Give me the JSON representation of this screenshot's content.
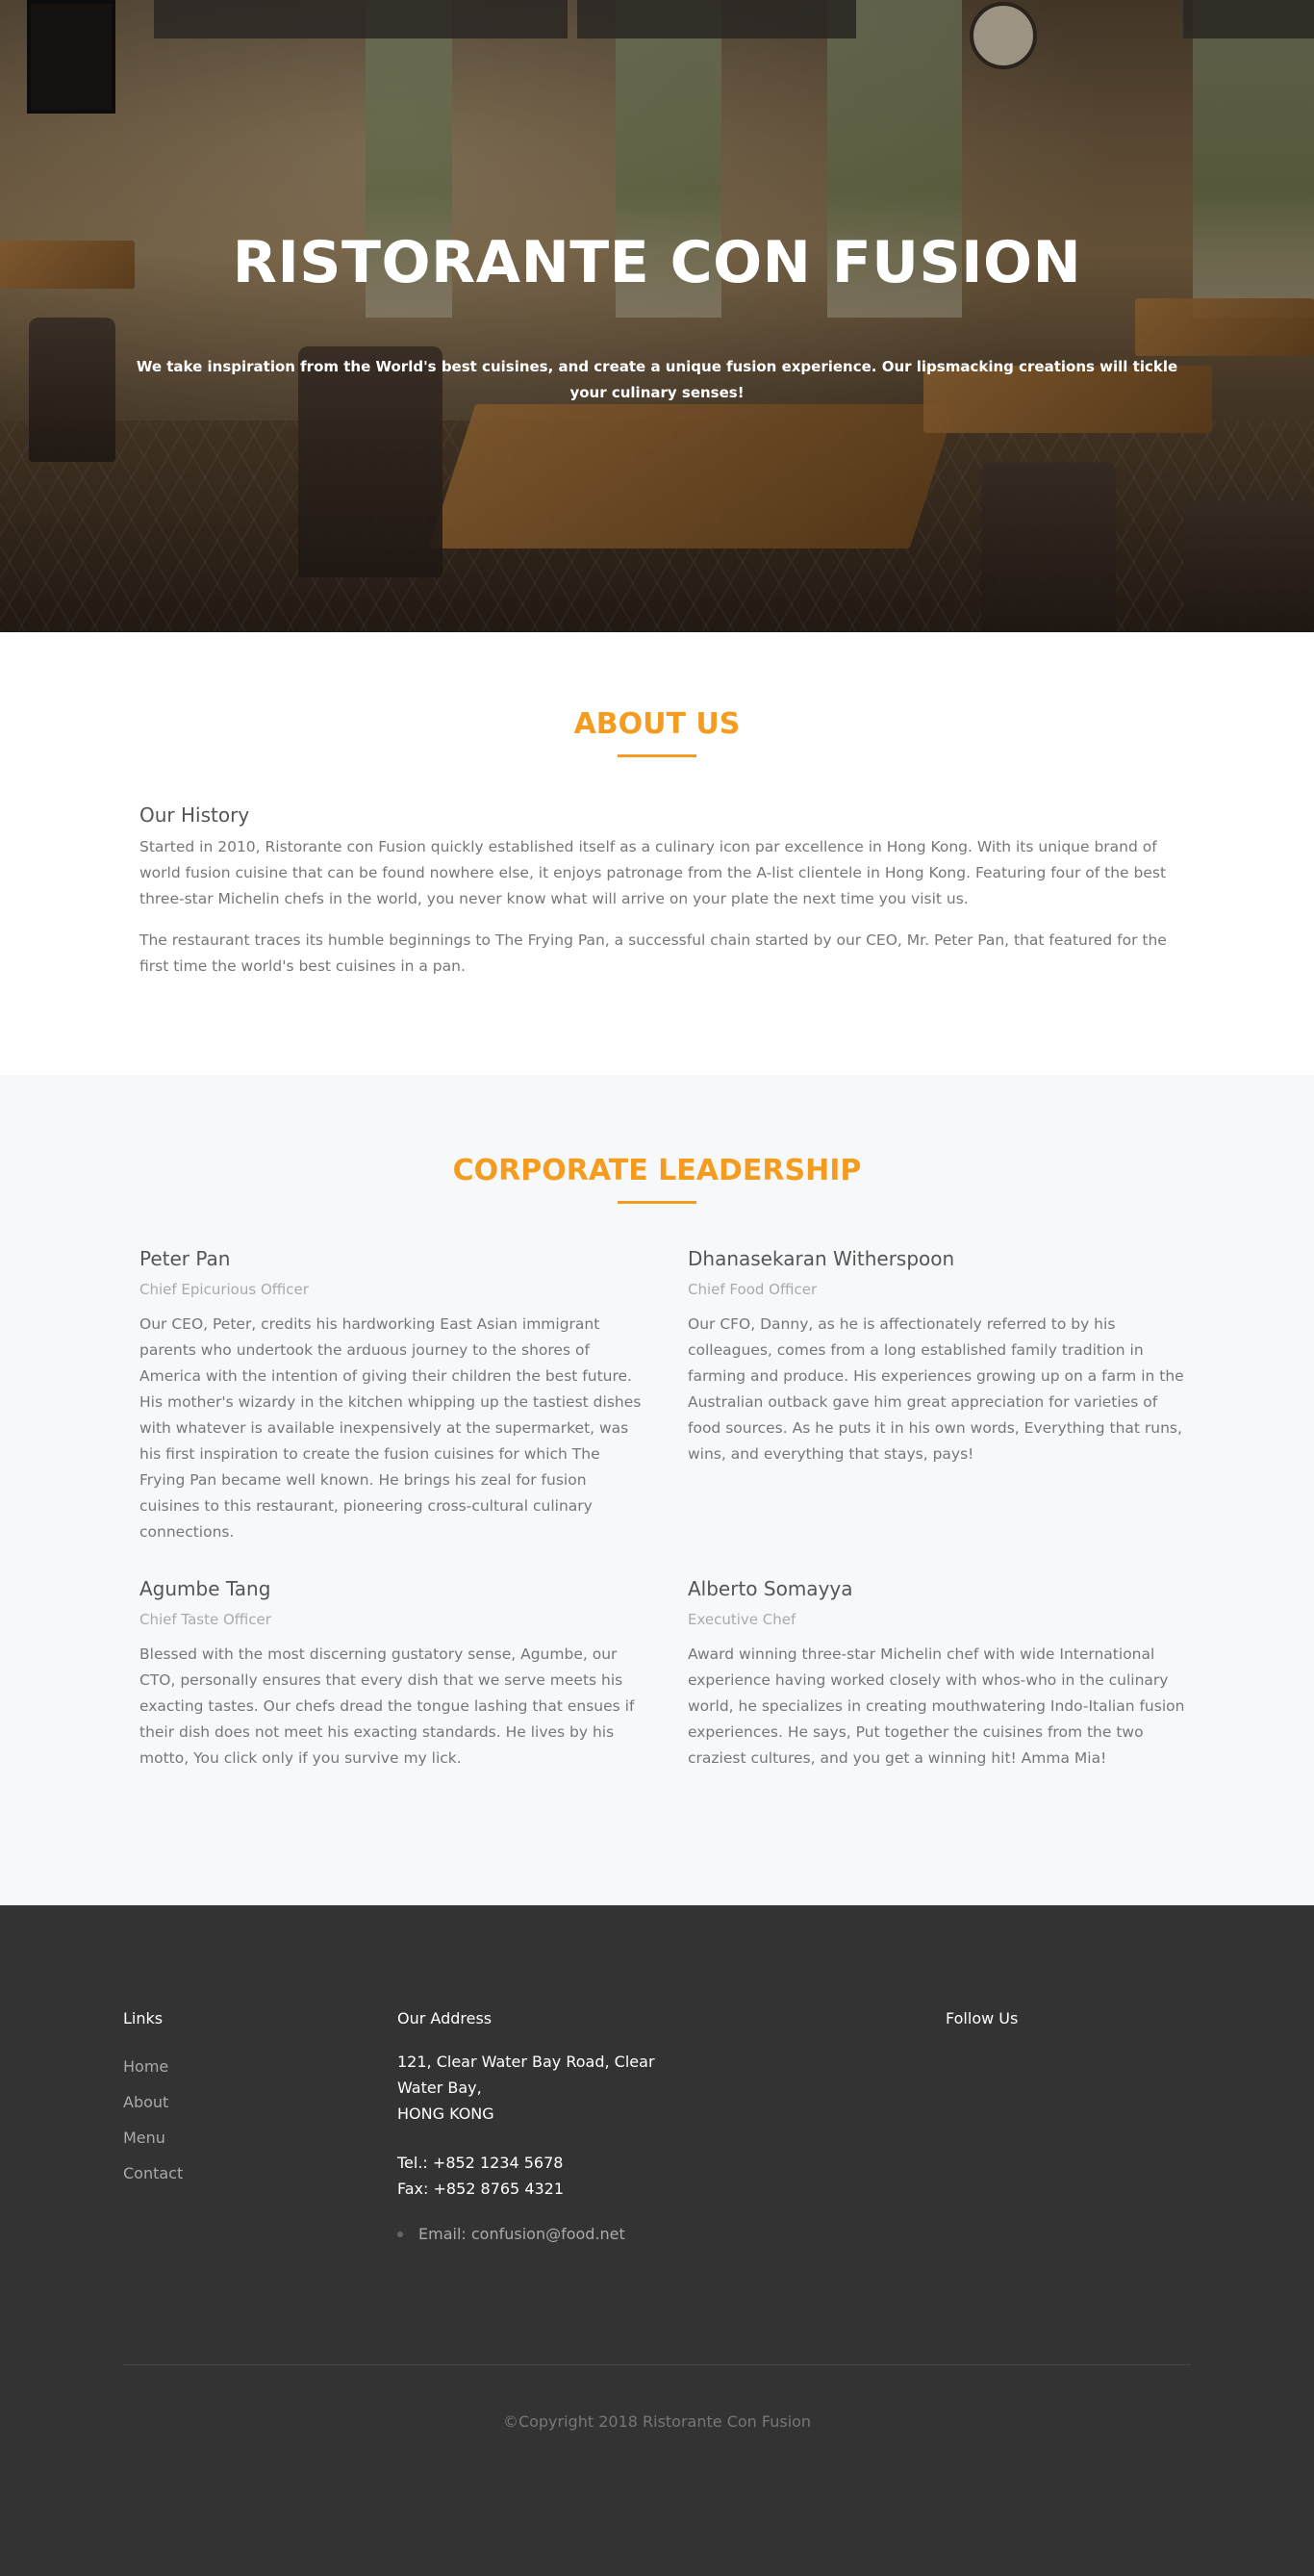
{
  "hero": {
    "title": "RISTORANTE CON FUSION",
    "subtitle": "We take inspiration from the World's best cuisines, and create a unique fusion experience. Our lipsmacking creations will tickle your culinary senses!"
  },
  "about": {
    "title": "ABOUT US",
    "heading": "Our History",
    "paragraphs": [
      "Started in 2010, Ristorante con Fusion quickly established itself as a culinary icon par excellence in Hong Kong. With its unique brand of world fusion cuisine that can be found nowhere else, it enjoys patronage from the A-list clientele in Hong Kong. Featuring four of the best three-star Michelin chefs in the world, you never know what will arrive on your plate the next time you visit us.",
      "The restaurant traces its humble beginnings to The Frying Pan, a successful chain started by our CEO, Mr. Peter Pan, that featured for the first time the world's best cuisines in a pan."
    ]
  },
  "leadership": {
    "title": "CORPORATE LEADERSHIP",
    "leaders": [
      {
        "name": "Peter Pan",
        "role": "Chief Epicurious Officer",
        "bio": "Our CEO, Peter, credits his hardworking East Asian immigrant parents who undertook the arduous journey to the shores of America with the intention of giving their children the best future. His mother's wizardy in the kitchen whipping up the tastiest dishes with whatever is available inexpensively at the supermarket, was his first inspiration to create the fusion cuisines for which The Frying Pan became well known. He brings his zeal for fusion cuisines to this restaurant, pioneering cross-cultural culinary connections."
      },
      {
        "name": "Dhanasekaran Witherspoon",
        "role": "Chief Food Officer",
        "bio": "Our CFO, Danny, as he is affectionately referred to by his colleagues, comes from a long established family tradition in farming and produce. His experiences growing up on a farm in the Australian outback gave him great appreciation for varieties of food sources. As he puts it in his own words, Everything that runs, wins, and everything that stays, pays!"
      },
      {
        "name": "Agumbe Tang",
        "role": "Chief Taste Officer",
        "bio": "Blessed with the most discerning gustatory sense, Agumbe, our CTO, personally ensures that every dish that we serve meets his exacting tastes. Our chefs dread the tongue lashing that ensues if their dish does not meet his exacting standards. He lives by his motto, You click only if you survive my lick."
      },
      {
        "name": "Alberto Somayya",
        "role": "Executive Chef",
        "bio": "Award winning three-star Michelin chef with wide International experience having worked closely with whos-who in the culinary world, he specializes in creating mouthwatering Indo-Italian fusion experiences. He says, Put together the cuisines from the two craziest cultures, and you get a winning hit! Amma Mia!"
      }
    ]
  },
  "footer": {
    "links_title": "Links",
    "links": [
      "Home",
      "About",
      "Menu",
      "Contact"
    ],
    "address_title": "Our Address",
    "address_line1": "121, Clear Water Bay Road, Clear",
    "address_line2": "Water Bay,",
    "address_line3": "HONG KONG",
    "tel": "Tel.: +852 1234 5678",
    "fax": "Fax: +852 8765 4321",
    "email": "Email: confusion@food.net",
    "follow_title": "Follow Us",
    "copyright": "©Copyright 2018 Ristorante Con Fusion"
  },
  "colors": {
    "accent": "#f39c1f",
    "footer_bg": "#333333",
    "section_bg": "#f7f8fa"
  }
}
